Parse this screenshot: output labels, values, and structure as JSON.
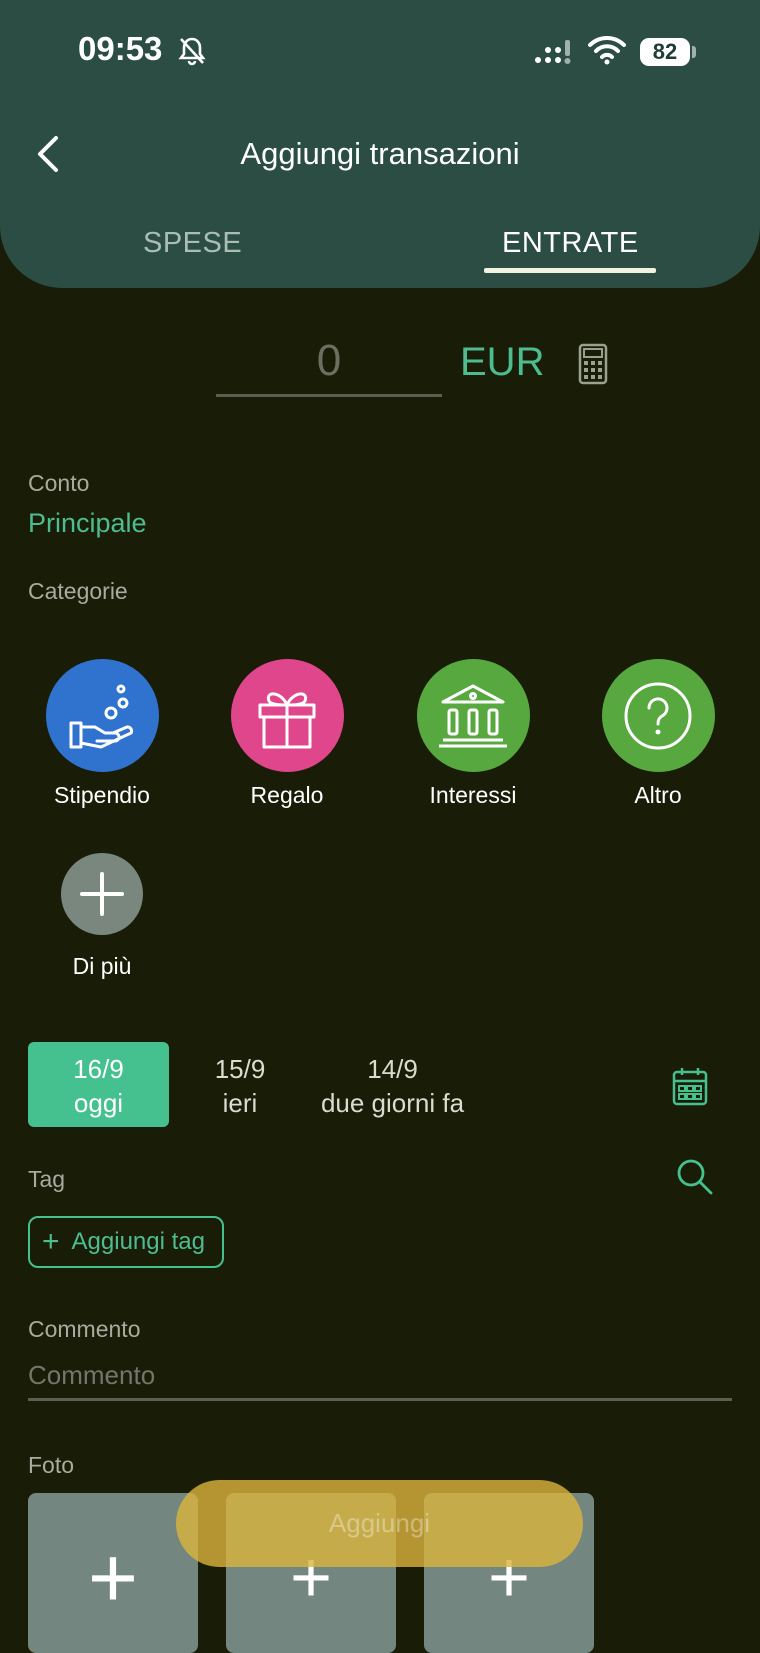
{
  "status_bar": {
    "time": "09:53",
    "battery": "82"
  },
  "header": {
    "title": "Aggiungi transazioni"
  },
  "tabs": [
    {
      "label": "SPESE",
      "active": false
    },
    {
      "label": "ENTRATE",
      "active": true
    }
  ],
  "amount": {
    "value": "0",
    "currency": "EUR"
  },
  "account": {
    "label": "Conto",
    "value": "Principale"
  },
  "categories": {
    "label": "Categorie",
    "items": [
      {
        "name": "Stipendio",
        "color": "#2f73cf",
        "icon": "hand-coins-icon"
      },
      {
        "name": "Regalo",
        "color": "#e0468b",
        "icon": "gift-icon"
      },
      {
        "name": "Interessi",
        "color": "#57a83f",
        "icon": "bank-icon"
      },
      {
        "name": "Altro",
        "color": "#57a83f",
        "icon": "question-icon"
      }
    ],
    "more": "Di più"
  },
  "dates": [
    {
      "date": "16/9",
      "label": "oggi",
      "selected": true
    },
    {
      "date": "15/9",
      "label": "ieri",
      "selected": false
    },
    {
      "date": "14/9",
      "label": "due giorni fa",
      "selected": false
    }
  ],
  "tag": {
    "label": "Tag",
    "add_label": "Aggiungi tag"
  },
  "comment": {
    "label": "Commento",
    "placeholder": "Commento"
  },
  "photo": {
    "label": "Foto"
  },
  "submit": {
    "label": "Aggiungi"
  },
  "colors": {
    "accent": "#4dbd91",
    "header": "#2b4d44",
    "background": "#191c06"
  }
}
